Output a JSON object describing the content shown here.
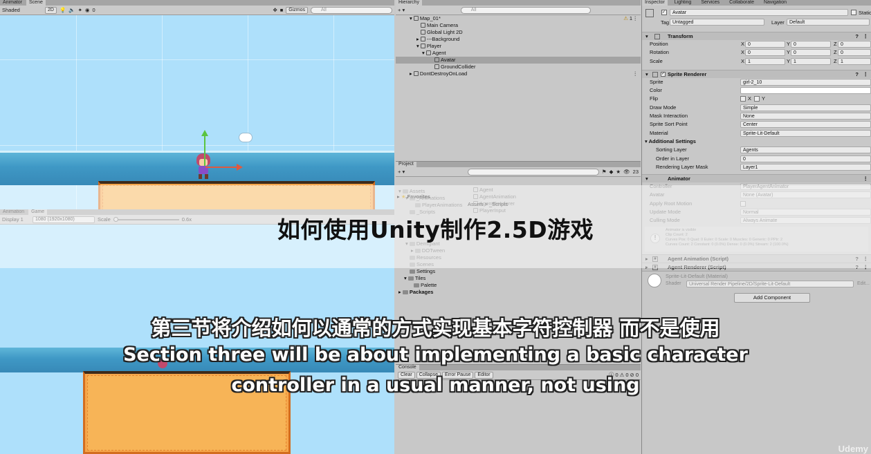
{
  "scene": {
    "tabs": [
      "Animator",
      "Scene"
    ],
    "shading": "Shaded",
    "mode_2d": "2D",
    "gizmo_count": "0",
    "gizmos": "Gizmos",
    "search": "All"
  },
  "game": {
    "tabs": [
      "Animation",
      "Game"
    ],
    "display": "Display 1",
    "resolution": "1080 (1920x1080)",
    "scale_label": "Scale",
    "scale_value": "0.6x"
  },
  "hierarchy": {
    "tab": "Hierarchy",
    "search": "All",
    "scene_name": "Map_01*",
    "item_count": "1",
    "items": [
      {
        "label": "Main Camera",
        "depth": 2
      },
      {
        "label": "Global Light 2D",
        "depth": 2
      },
      {
        "label": "---Background",
        "depth": 2
      },
      {
        "label": "Player",
        "depth": 2
      },
      {
        "label": "Agent",
        "depth": 3
      },
      {
        "label": "Avatar",
        "depth": 4
      },
      {
        "label": "GroundCollider",
        "depth": 4
      }
    ],
    "dontdestroy": "DontDestroyOnLoad"
  },
  "project": {
    "tab": "Project",
    "search_count": "23",
    "favorites": "Favorites",
    "breadcrumb": "Assets > _Scripts",
    "tree": [
      {
        "label": "Assets",
        "depth": 0
      },
      {
        "label": "_Animations",
        "depth": 1
      },
      {
        "label": "PlayerAnimations",
        "depth": 2
      },
      {
        "label": "_Scripts",
        "depth": 1
      },
      {
        "label": "Demigiant",
        "depth": 1
      },
      {
        "label": "DOTween",
        "depth": 2
      },
      {
        "label": "Resources",
        "depth": 1
      },
      {
        "label": "Scenes",
        "depth": 1
      },
      {
        "label": "Settings",
        "depth": 1
      },
      {
        "label": "Tiles",
        "depth": 1
      },
      {
        "label": "Palette",
        "depth": 2
      },
      {
        "label": "Packages",
        "depth": 0
      }
    ],
    "files": [
      "Agent",
      "AgentAnimation",
      "AgentRenderer",
      "PlayerInput"
    ]
  },
  "console": {
    "tab": "Console",
    "clear": "Clear",
    "collapse": "Collapse",
    "error_pause": "Error Pause",
    "editor": "Editor",
    "counts": [
      "0",
      "0",
      "0"
    ]
  },
  "inspector": {
    "tabs": [
      "Inspector",
      "Lighting",
      "Services",
      "Collaborate",
      "Navigation"
    ],
    "object_name": "Avatar",
    "static": "Static",
    "tag_label": "Tag",
    "tag": "Untagged",
    "layer_label": "Layer",
    "layer": "Default",
    "transform": {
      "title": "Transform",
      "position": {
        "label": "Position",
        "x": "0",
        "y": "0",
        "z": "0"
      },
      "rotation": {
        "label": "Rotation",
        "x": "0",
        "y": "0",
        "z": "0"
      },
      "scale": {
        "label": "Scale",
        "x": "1",
        "y": "1",
        "z": "1"
      }
    },
    "sprite_renderer": {
      "title": "Sprite Renderer",
      "sprite": {
        "label": "Sprite",
        "value": "girl-2_10"
      },
      "color": {
        "label": "Color"
      },
      "flip": {
        "label": "Flip",
        "x": "X",
        "y": "Y"
      },
      "draw_mode": {
        "label": "Draw Mode",
        "value": "Simple"
      },
      "mask": {
        "label": "Mask Interaction",
        "value": "None"
      },
      "sort_point": {
        "label": "Sprite Sort Point",
        "value": "Center"
      },
      "material": {
        "label": "Material",
        "value": "Sprite-Lit-Default"
      },
      "additional": "Additional Settings",
      "sorting_layer": {
        "label": "Sorting Layer",
        "value": "Agents"
      },
      "order": {
        "label": "Order in Layer",
        "value": "0"
      },
      "rendering_mask": {
        "label": "Rendering Layer Mask",
        "value": "Layer1"
      }
    },
    "animator": {
      "title": "Animator",
      "controller": {
        "label": "Controller",
        "value": "PlayerAgentAnimator"
      },
      "avatar": {
        "label": "Avatar",
        "value": "None (Avatar)"
      },
      "root_motion": {
        "label": "Apply Root Motion"
      },
      "update_mode": {
        "label": "Update Mode",
        "value": "Normal"
      },
      "culling": {
        "label": "Culling Mode",
        "value": "Always Animate"
      },
      "info": [
        "Animator is visible",
        "Clip Count: 2",
        "Curves Pos: 0 Quat: 0 Euler: 0 Scale: 0 Muscles: 0 Generic: 0 PPtr: 2",
        "Curves Count: 2 Constant: 0 (0.0%) Dense: 0 (0.0%) Stream: 2 (100.0%)"
      ]
    },
    "scripts": [
      "Agent Animation (Script)",
      "Agent Renderer (Script)"
    ],
    "material_comp": {
      "title": "Sprite-Lit-Default (Material)",
      "shader_label": "Shader",
      "shader": "Universal Render Pipeline/2D/Sprite-Lit-Default",
      "edit": "Edit..."
    },
    "add_component": "Add Component"
  },
  "overlay": {
    "title": "如何使用Unity制作2.5D游戏",
    "subtitle_cn": "第三节将介绍如何以通常的方式实现基本字符控制器 而不是使用",
    "subtitle_en_1": "Section three will be about implementing a basic character",
    "subtitle_en_2": "controller in a usual manner, not using",
    "watermark": "Udemy"
  }
}
